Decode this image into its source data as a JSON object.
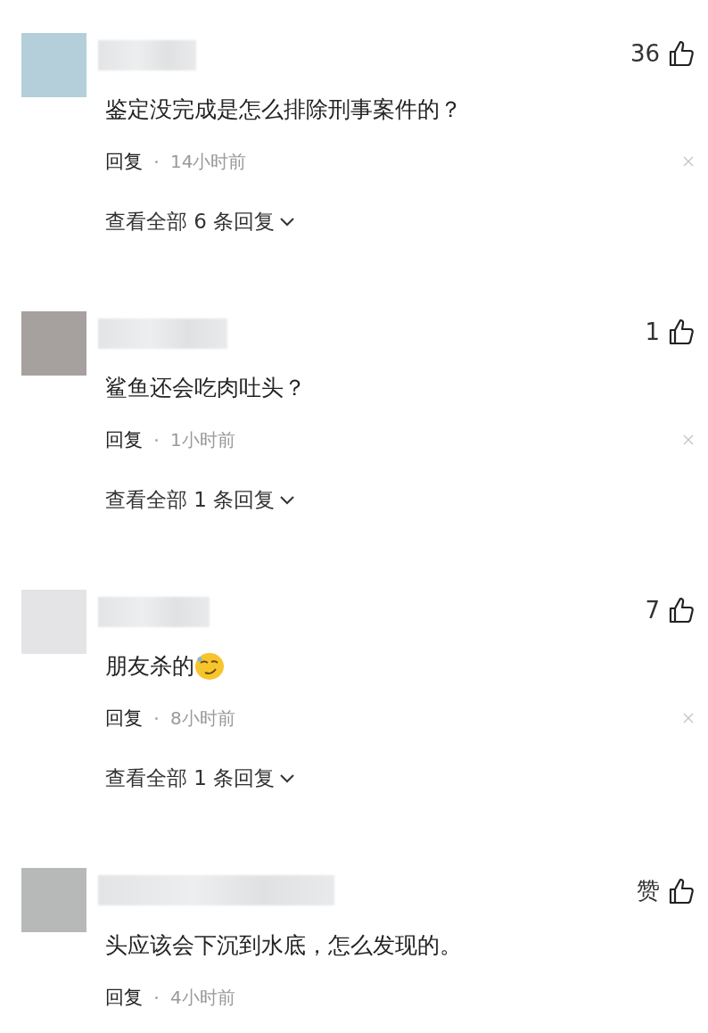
{
  "comments": [
    {
      "color": "#b4cfd9",
      "likes": "36",
      "content": "鉴定没完成是怎么排除刑事案件的？",
      "has_emoji": false,
      "reply": "回复",
      "time": "14小时前",
      "dismissible": true,
      "view_replies": "查看全部 6 条回复"
    },
    {
      "color": "#a6a09f",
      "likes": "1",
      "content": "鲨鱼还会吃肉吐头？",
      "has_emoji": false,
      "reply": "回复",
      "time": "1小时前",
      "dismissible": true,
      "view_replies": "查看全部 1 条回复"
    },
    {
      "color": "#e4e4e6",
      "likes": "7",
      "content": "朋友杀的",
      "has_emoji": true,
      "reply": "回复",
      "time": "8小时前",
      "dismissible": true,
      "view_replies": "查看全部 1 条回复"
    },
    {
      "color": "#b7b8b8",
      "likes": "赞",
      "content": "头应该会下沉到水底，怎么发现的。",
      "has_emoji": false,
      "reply": "回复",
      "time": "4小时前",
      "dismissible": false
    }
  ]
}
